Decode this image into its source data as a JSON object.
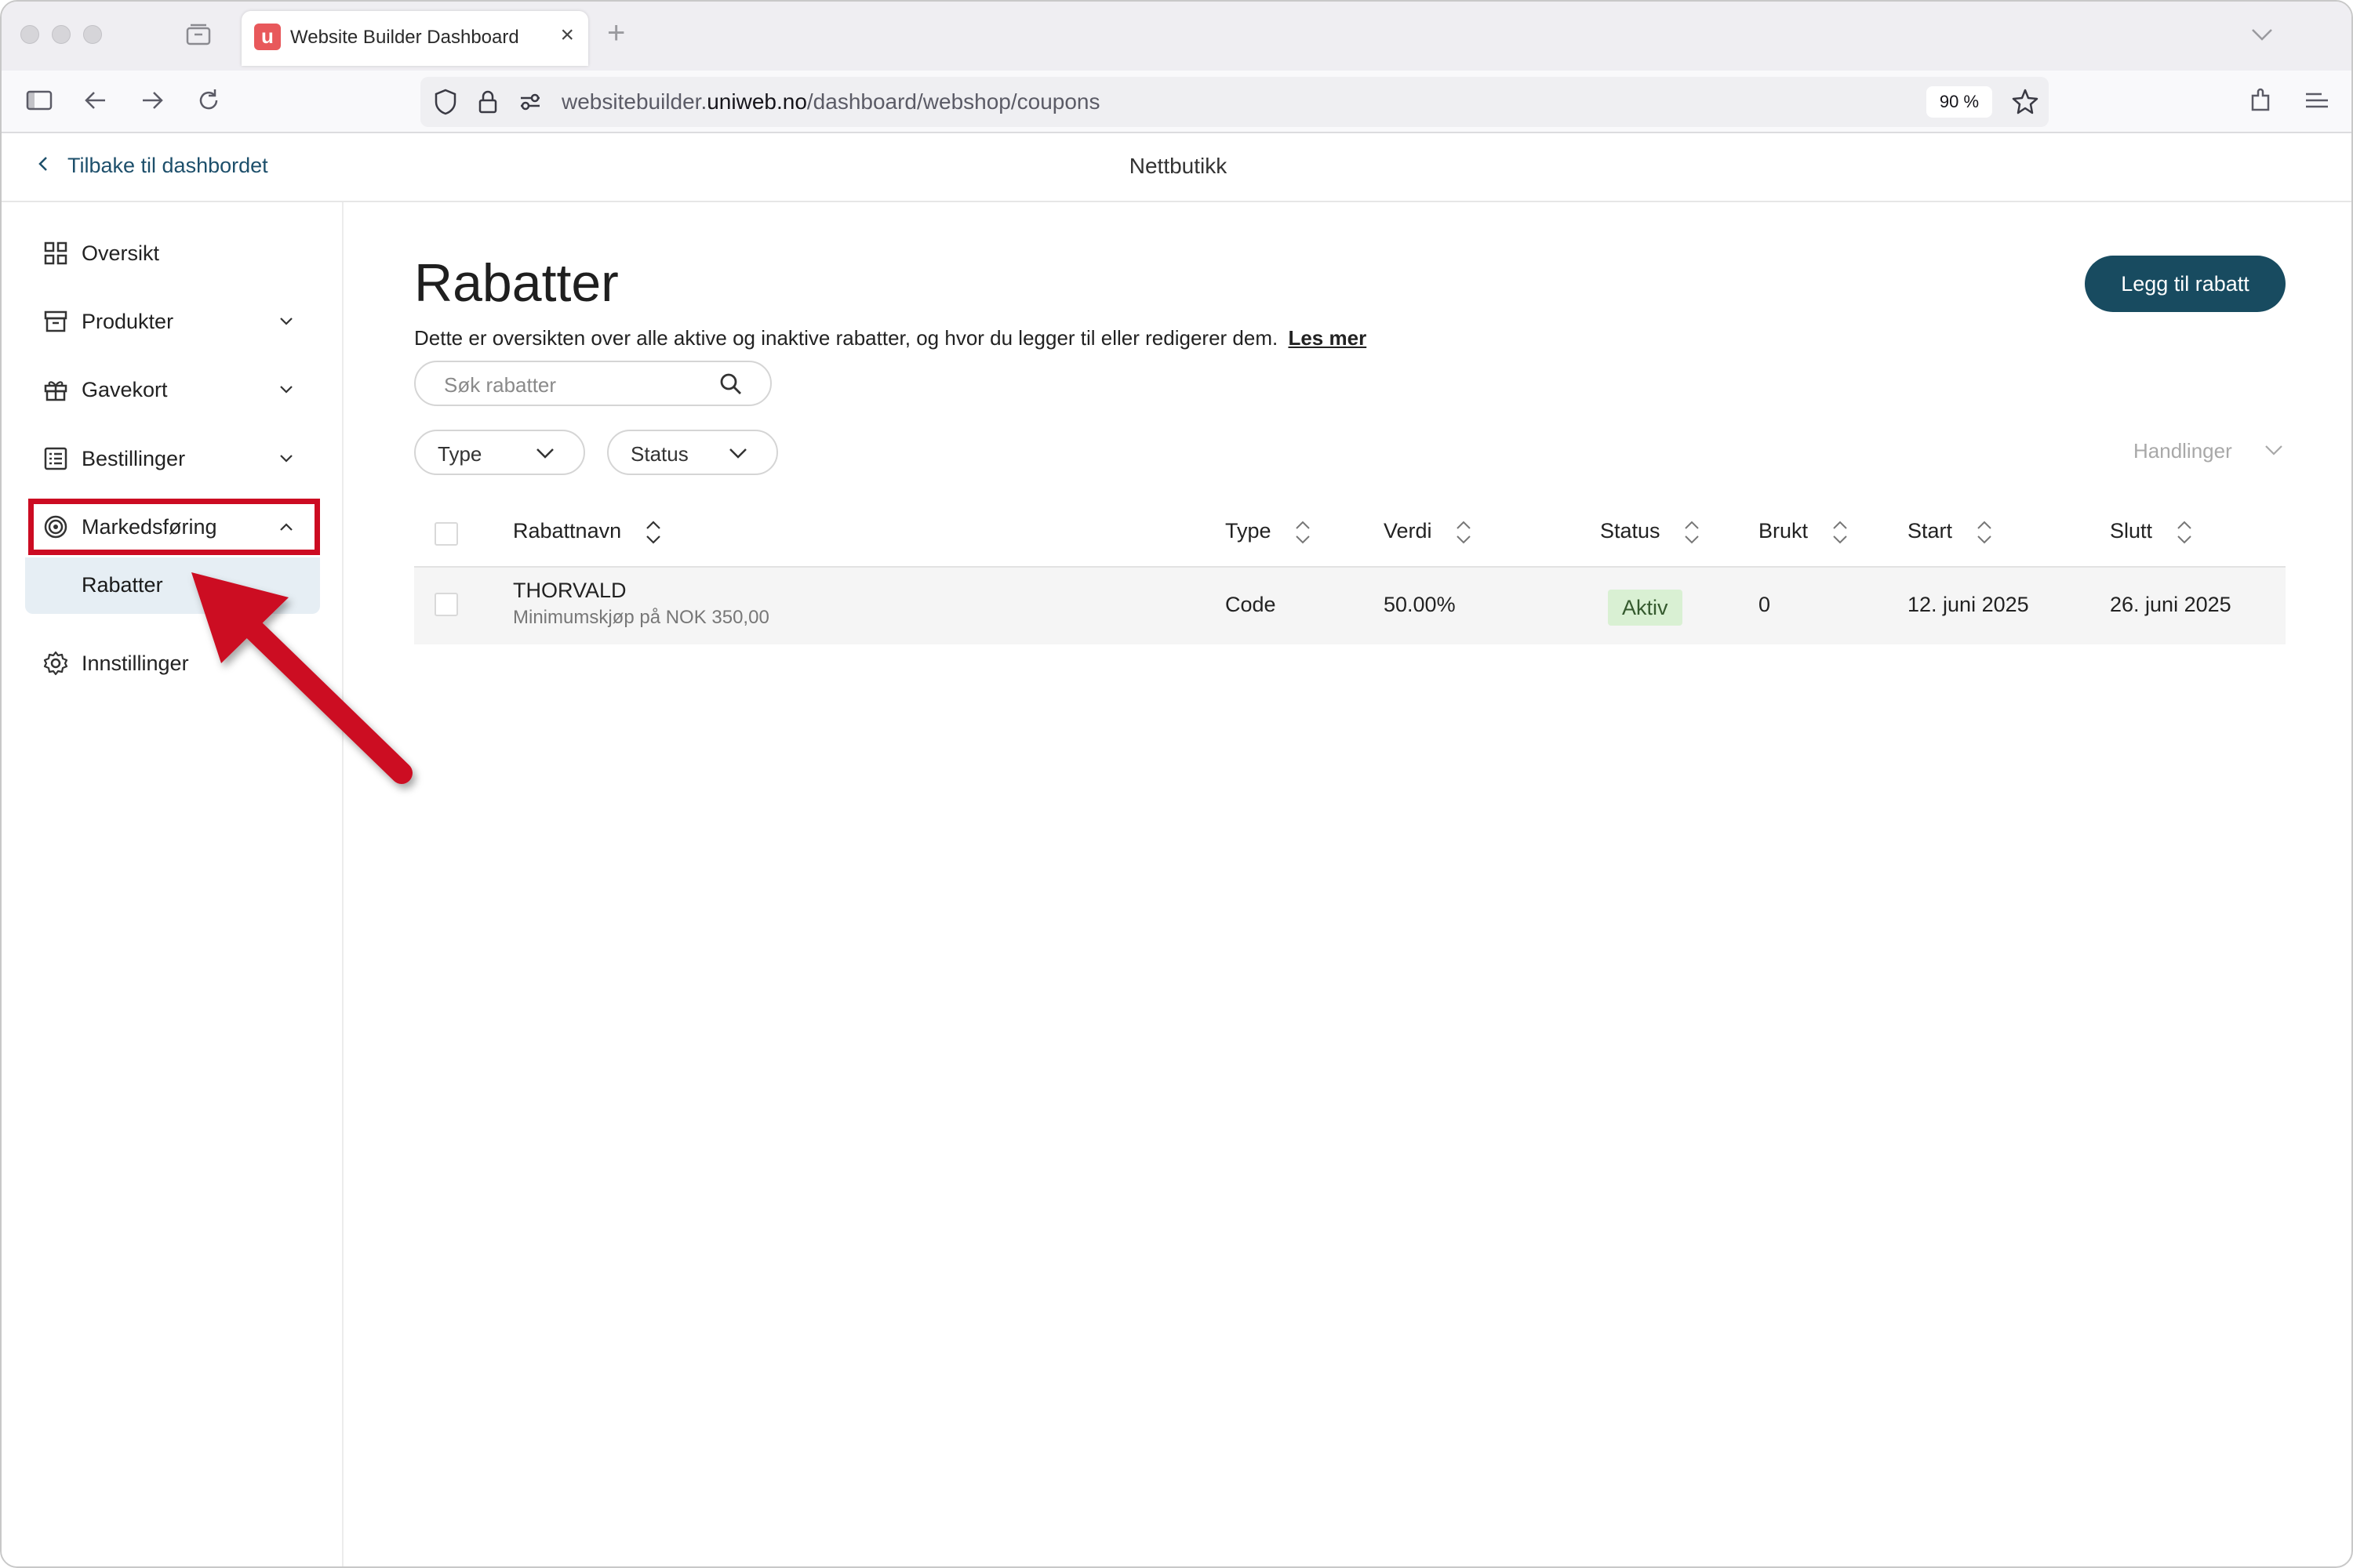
{
  "browser": {
    "tab_title": "Website Builder Dashboard",
    "tab_favicon": "u",
    "url_prefix": "websitebuilder.",
    "url_domain": "uniweb.no",
    "url_path": "/dashboard/webshop/coupons",
    "zoom": "90 %"
  },
  "header": {
    "back_label": "Tilbake til dashbordet",
    "title": "Nettbutikk"
  },
  "sidebar": {
    "items": [
      {
        "label": "Oversikt",
        "icon": "grid-icon"
      },
      {
        "label": "Produkter",
        "icon": "archive-box-icon"
      },
      {
        "label": "Gavekort",
        "icon": "gift-icon"
      },
      {
        "label": "Bestillinger",
        "icon": "list-icon"
      },
      {
        "label": "Markedsføring",
        "icon": "target-icon"
      },
      {
        "label": "Innstillinger",
        "icon": "gear-icon"
      }
    ],
    "sub_item": "Rabatter"
  },
  "main": {
    "title": "Rabatter",
    "description": "Dette er oversikten over alle aktive og inaktive rabatter, og hvor du legger til eller redigerer dem.",
    "read_more": "Les mer",
    "add_button": "Legg til rabatt",
    "search_placeholder": "Søk rabatter",
    "filters": [
      "Type",
      "Status"
    ],
    "actions_label": "Handlinger"
  },
  "table": {
    "columns": [
      "Rabattnavn",
      "Type",
      "Verdi",
      "Status",
      "Brukt",
      "Start",
      "Slutt"
    ],
    "rows": [
      {
        "name": "THORVALD",
        "subtitle": "Minimumskjøp på NOK 350,00",
        "type": "Code",
        "value": "50.00%",
        "status": "Aktiv",
        "used": "0",
        "start": "12. juni 2025",
        "end": "26. juni 2025"
      }
    ]
  },
  "colors": {
    "accent": "#184b60",
    "highlight": "#cc0b22",
    "status_active_bg": "#d9f0d3"
  }
}
